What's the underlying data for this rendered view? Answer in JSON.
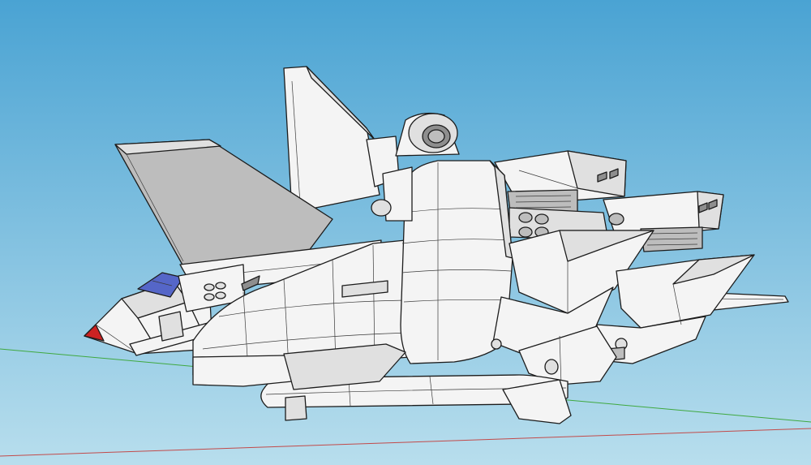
{
  "viewport": {
    "sky_top_color": "#4aa3d3",
    "sky_bottom_color": "#b8deed",
    "green_axis_color": "#3fa83f",
    "red_axis_color": "#c24a4a"
  },
  "model": {
    "fill_light": "#f4f4f4",
    "fill_mid": "#e0e0e0",
    "fill_shadow": "#bdbdbd",
    "fill_dark": "#8e8e8e",
    "canopy_color": "#5566c8",
    "nose_tip_color": "#cc2222",
    "outline_color": "#1c1c1c"
  }
}
